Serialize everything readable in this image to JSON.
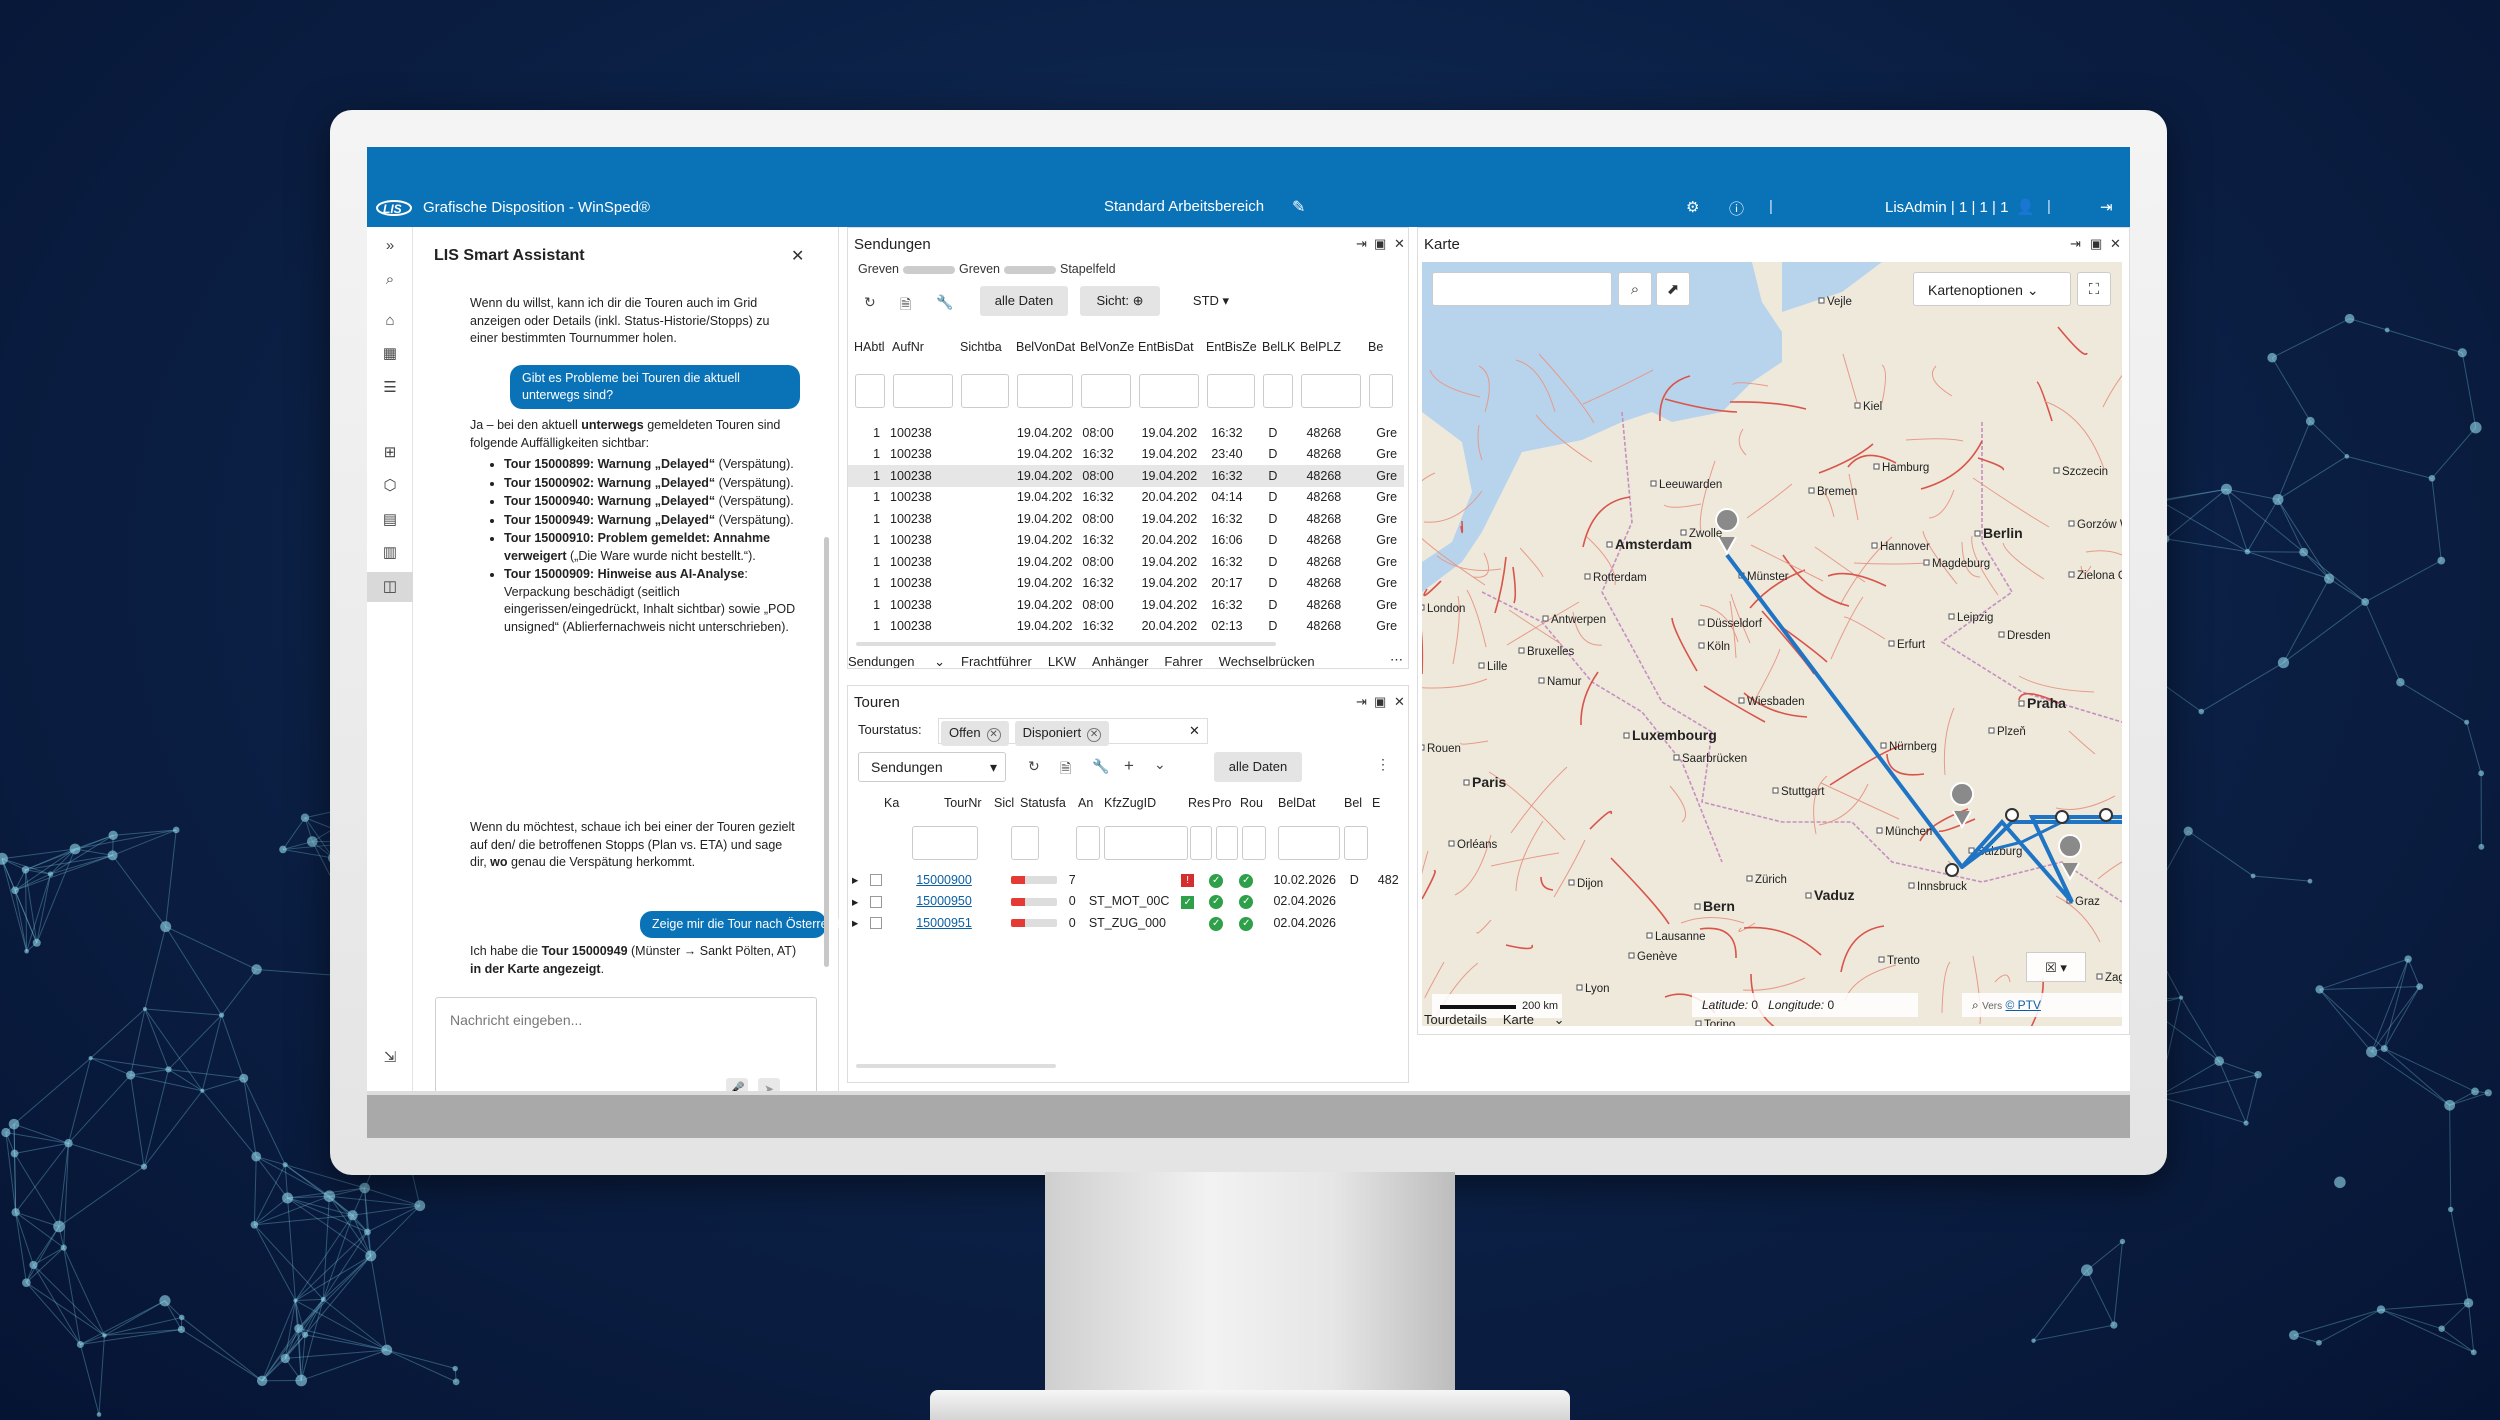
{
  "app": {
    "title": "Grafische Disposition - WinSped®",
    "workspace": "Standard Arbeitsbereich",
    "user": "LisAdmin",
    "user_counts": "1 | 1 | 1",
    "brand_color": "#0a73b8"
  },
  "assistant": {
    "title": "LIS Smart Assistant",
    "intro": "Wenn du willst, kann ich dir die Touren auch im Grid anzeigen oder Details (inkl. Status-Historie/Stopps) zu einer bestimmten Tournummer holen.",
    "user_question": "Gibt es Probleme bei Touren die aktuell unterwegs sind?",
    "answer_lead_1": "Ja – bei den aktuell ",
    "answer_lead_bold": "unterwegs",
    "answer_lead_2": " gemeldeten Touren sind folgende Auffälligkeiten sichtbar:",
    "issues": [
      {
        "bold": "Tour 15000899: Warnung „Delayed“",
        "rest": " (Verspätung)."
      },
      {
        "bold": "Tour 15000902: Warnung „Delayed“",
        "rest": " (Verspätung)."
      },
      {
        "bold": "Tour 15000940: Warnung „Delayed“",
        "rest": " (Verspätung)."
      },
      {
        "bold": "Tour 15000949: Warnung „Delayed“",
        "rest": " (Verspätung)."
      },
      {
        "bold": "Tour 15000910: Problem gemeldet: Annahme verweigert",
        "rest": " („Die Ware wurde nicht bestellt.“)."
      },
      {
        "bold": "Tour 15000909: Hinweise aus AI-Analyse",
        "rest": ": Verpackung beschädigt (seitlich eingerissen/eingedrückt, Inhalt sichtbar) sowie „POD unsigned“ (Ablierfernachweis nicht unterschrieben)."
      }
    ],
    "followup_1": "Wenn du möchtest, schaue ich bei einer der Touren gezielt auf den/ die betroffenen Stopps (Plan vs. ETA) und sage dir, ",
    "followup_bold": "wo",
    "followup_2": " genau die Verspätung herkommt.",
    "user_request": "Zeige mir die Tour nach Österreich in der Karte.",
    "result_1": "Ich habe die ",
    "result_bold_1": "Tour 15000949",
    "result_2": " (Münster → Sankt Pölten, AT) ",
    "result_bold_2": "in der Karte angezeigt",
    "result_3": ".",
    "input_placeholder": "Nachricht eingeben..."
  },
  "sendungen": {
    "title": "Sendungen",
    "breadcrumb": [
      "Greven",
      "Greven",
      "Stapelfeld"
    ],
    "btn_all": "alle Daten",
    "btn_view": "Sicht:",
    "btn_std": "STD",
    "columns": [
      "HAbtl",
      "AufNr",
      "Sichtba",
      "BelVonDat",
      "BelVonZe",
      "EntBisDat",
      "EntBisZe",
      "BelLK",
      "BelPLZ",
      "Be"
    ],
    "rows": [
      [
        "1",
        "100238",
        "",
        "19.04.202",
        "08:00",
        "19.04.202",
        "16:32",
        "D",
        "48268",
        "Gre"
      ],
      [
        "1",
        "100238",
        "",
        "19.04.202",
        "16:32",
        "19.04.202",
        "23:40",
        "D",
        "48268",
        "Gre"
      ],
      [
        "1",
        "100238",
        "",
        "19.04.202",
        "08:00",
        "19.04.202",
        "16:32",
        "D",
        "48268",
        "Gre"
      ],
      [
        "1",
        "100238",
        "",
        "19.04.202",
        "16:32",
        "20.04.202",
        "04:14",
        "D",
        "48268",
        "Gre"
      ],
      [
        "1",
        "100238",
        "",
        "19.04.202",
        "08:00",
        "19.04.202",
        "16:32",
        "D",
        "48268",
        "Gre"
      ],
      [
        "1",
        "100238",
        "",
        "19.04.202",
        "16:32",
        "20.04.202",
        "16:06",
        "D",
        "48268",
        "Gre"
      ],
      [
        "1",
        "100238",
        "",
        "19.04.202",
        "08:00",
        "19.04.202",
        "16:32",
        "D",
        "48268",
        "Gre"
      ],
      [
        "1",
        "100238",
        "",
        "19.04.202",
        "16:32",
        "19.04.202",
        "20:17",
        "D",
        "48268",
        "Gre"
      ],
      [
        "1",
        "100238",
        "",
        "19.04.202",
        "08:00",
        "19.04.202",
        "16:32",
        "D",
        "48268",
        "Gre"
      ],
      [
        "1",
        "100238",
        "",
        "19.04.202",
        "16:32",
        "20.04.202",
        "02:13",
        "D",
        "48268",
        "Gre"
      ]
    ],
    "tabs": [
      "Sendungen",
      "Frachtführer",
      "LKW",
      "Anhänger",
      "Fahrer",
      "Wechselbrücken"
    ]
  },
  "touren": {
    "title": "Touren",
    "status_label": "Tourstatus:",
    "chips": [
      "Offen",
      "Disponiert"
    ],
    "select_value": "Sendungen",
    "btn_all": "alle Daten",
    "columns": [
      "Ka",
      "TourNr",
      "Sicl",
      "Statusfa",
      "An",
      "KfzZugID",
      "Res",
      "Pro",
      "Rou",
      "BelDat",
      "Bel",
      "E"
    ],
    "rows": [
      {
        "tour": "15000900",
        "an": "7",
        "kfz": "",
        "res": "error",
        "bel_dat": "10.02.2026",
        "bel": "D",
        "e": "482"
      },
      {
        "tour": "15000950",
        "an": "0",
        "kfz": "ST_MOT_00C",
        "res": "check",
        "bel_dat": "02.04.2026",
        "bel": "",
        "e": ""
      },
      {
        "tour": "15000951",
        "an": "0",
        "kfz": "ST_ZUG_000",
        "res": "",
        "bel_dat": "02.04.2026",
        "bel": "",
        "e": ""
      }
    ]
  },
  "karte": {
    "title": "Karte",
    "options_label": "Kartenoptionen",
    "scale": "200 km",
    "lat_label": "Latitude:",
    "lat_value": "0",
    "lon_label": "Longitude:",
    "lon_value": "0",
    "attribution": "© PTV Logistics,HERE",
    "attribution_prefix": "Vers",
    "route_color": "#1f74c4",
    "cities": [
      "Vejle",
      "Kiel",
      "Hamburg",
      "Szczecin",
      "Leeuwarden",
      "Bremen",
      "Gorzów Wielkopolski",
      "Zwolle",
      "Berlin",
      "Zielona Góra",
      "Amsterdam",
      "Hannover",
      "Magdeburg",
      "Münster",
      "Rotterdam",
      "Leipzig",
      "Antwerpen",
      "Dresden",
      "Bruxelles",
      "Düsseldorf",
      "Erfurt",
      "Köln",
      "Lille",
      "Namur",
      "Wiesbaden",
      "Praha",
      "Luxembourg",
      "Nürnberg",
      "Plzeň",
      "Rouen",
      "Saarbrücken",
      "Paris",
      "Stuttgart",
      "Orléans",
      "München",
      "Salzburg",
      "Dijon",
      "Zürich",
      "Innsbruck",
      "Bern",
      "Vaduz",
      "Graz",
      "Lausanne",
      "Genève",
      "Lyon",
      "Trento",
      "Torino",
      "Zagr",
      "London"
    ],
    "bottom_tabs": [
      "Tourdetails",
      "Karte"
    ]
  }
}
